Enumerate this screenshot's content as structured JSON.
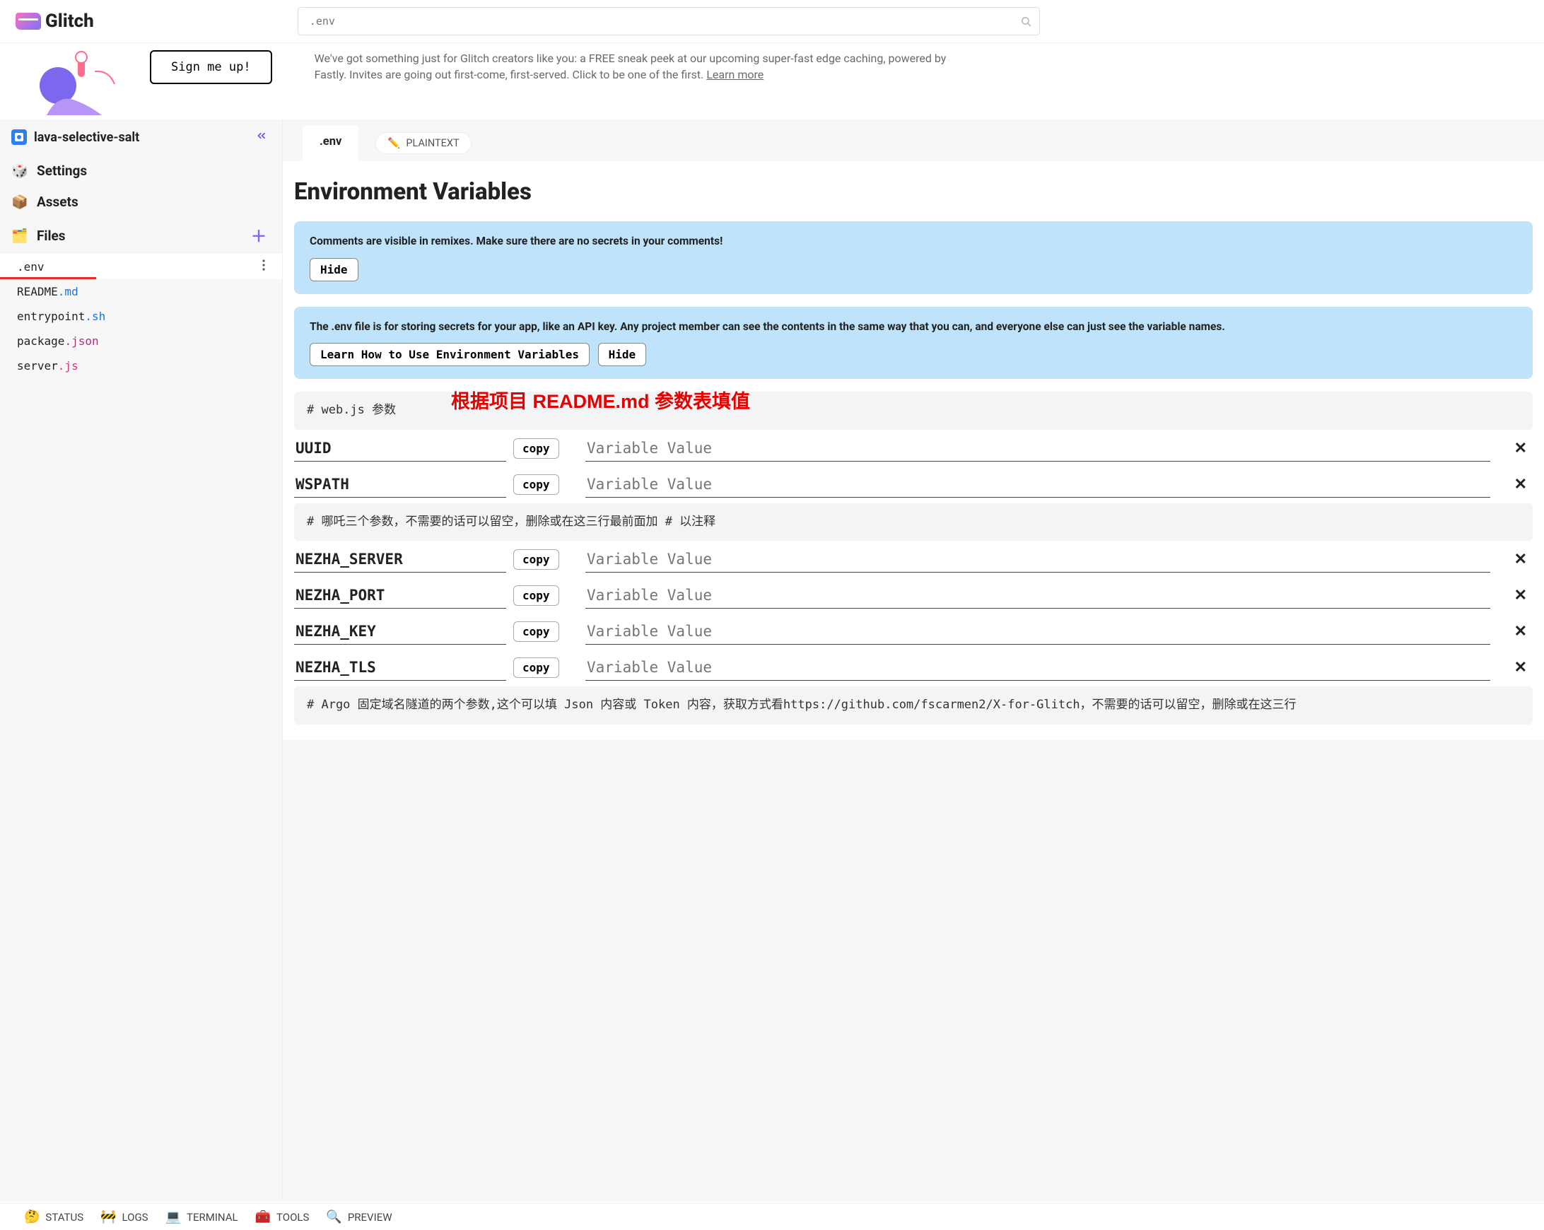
{
  "brand": "Glitch",
  "search": {
    "placeholder": ".env"
  },
  "banner": {
    "signup_label": "Sign me up!",
    "text": "We've got something just for Glitch creators like you: a FREE sneak peek at our upcoming super-fast edge caching, powered by Fastly. Invites are going out first-come, first-served. Click to be one of the first. ",
    "link": "Learn more"
  },
  "sidebar": {
    "project_name": "lava-selective-salt",
    "items": [
      {
        "label": "Settings"
      },
      {
        "label": "Assets"
      },
      {
        "label": "Files"
      }
    ],
    "files": [
      {
        "name": ".env",
        "active": true
      },
      {
        "base": "README",
        "ext": ".md",
        "extClass": "hl-md"
      },
      {
        "base": "entrypoint",
        "ext": ".sh",
        "extClass": "hl-sh"
      },
      {
        "base": "package",
        "ext": ".json",
        "extClass": "hl-json"
      },
      {
        "base": "server",
        "ext": ".js",
        "extClass": "hl-js"
      }
    ]
  },
  "tabs": {
    "active": ".env",
    "badge_label": "PLAINTEXT"
  },
  "page_title": "Environment Variables",
  "info1": {
    "text": "Comments are visible in remixes. Make sure there are no secrets in your comments!",
    "hide": "Hide"
  },
  "info2": {
    "text": "The .env file is for storing secrets for your app, like an API key. Any project member can see the contents in the same way that you can, and everyone else can just see the variable names.",
    "learn": "Learn How to Use Environment Variables",
    "hide": "Hide"
  },
  "annotation": "根据项目 README.md 参数表填值",
  "comment1": "# web.js 参数",
  "comment2": "# 哪吒三个参数，不需要的话可以留空，删除或在这三行最前面加 # 以注释",
  "comment3": "# Argo 固定域名隧道的两个参数,这个可以填 Json 内容或 Token 内容，获取方式看https://github.com/fscarmen2/X-for-Glitch，不需要的话可以留空，删除或在这三行",
  "copy_label": "copy",
  "value_placeholder": "Variable Value",
  "vars_a": [
    "UUID",
    "WSPATH"
  ],
  "vars_b": [
    "NEZHA_SERVER",
    "NEZHA_PORT",
    "NEZHA_KEY",
    "NEZHA_TLS"
  ],
  "footer": {
    "status": "STATUS",
    "logs": "LOGS",
    "terminal": "TERMINAL",
    "tools": "TOOLS",
    "preview": "PREVIEW"
  }
}
